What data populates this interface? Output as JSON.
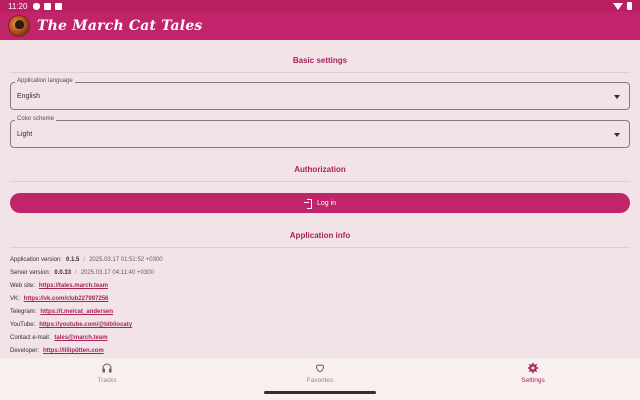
{
  "status_bar": {
    "time": "11:20"
  },
  "app_bar": {
    "title": "The March Cat Tales"
  },
  "sections": {
    "basic": "Basic settings",
    "authorization": "Authorization",
    "info": "Application info"
  },
  "fields": {
    "language": {
      "label": "Application language",
      "value": "English"
    },
    "color_scheme": {
      "label": "Color scheme",
      "value": "Light"
    }
  },
  "login_button": {
    "label": "Log in"
  },
  "info": {
    "app_version": {
      "label": "Application version:",
      "value": "0.1.5",
      "date": "2025.03.17 01:51:52 +0300"
    },
    "server_version": {
      "label": "Server version:",
      "value": "0.0.33",
      "date": "2025.03.17 04:11:40 +0300"
    },
    "website": {
      "label": "Web site:",
      "link": "https://tales.march.team"
    },
    "vk": {
      "label": "VK:",
      "link": "https://vk.com/club227997256"
    },
    "telegram": {
      "label": "Telegram:",
      "link": "https://t.me/cat_andersen"
    },
    "youtube": {
      "label": "YouTube:",
      "link": "https://youtube.com/@bibliocaty"
    },
    "email": {
      "label": "Contact e-mail:",
      "link": "tales@march.team"
    },
    "developer": {
      "label": "Developer:",
      "link": "https://lillipütten.com"
    },
    "separator": "/"
  },
  "bottom_nav": {
    "items": [
      {
        "label": "Tracks",
        "icon": "headphones-icon",
        "active": false
      },
      {
        "label": "Favorites",
        "icon": "heart-icon",
        "active": false
      },
      {
        "label": "Settings",
        "icon": "gear-icon",
        "active": true
      }
    ]
  },
  "colors": {
    "primary": "#c1246a",
    "background": "#f1e3e6",
    "active_nav": "#a8235c"
  }
}
